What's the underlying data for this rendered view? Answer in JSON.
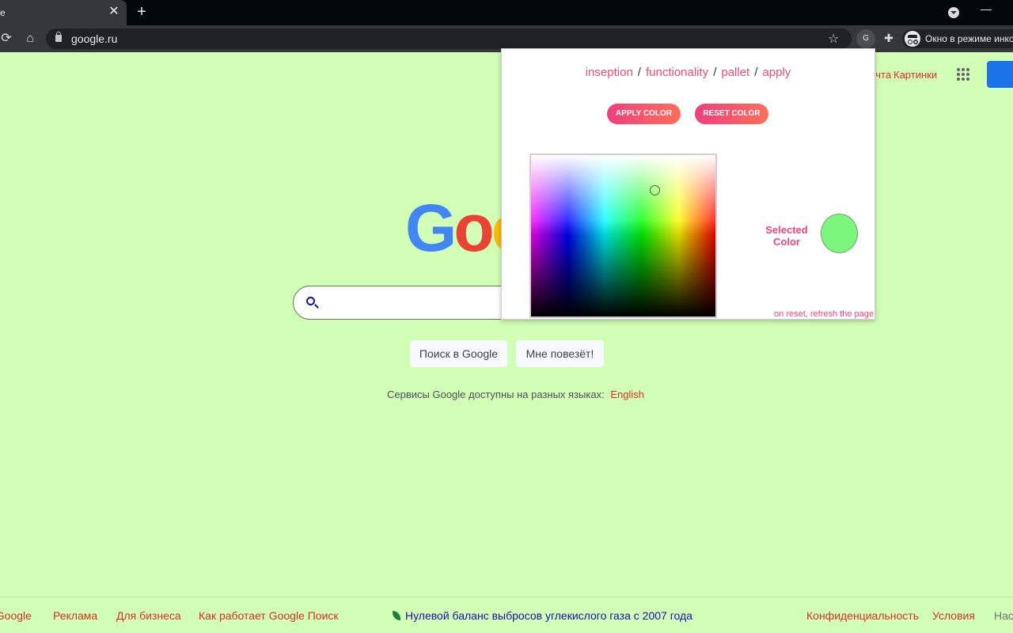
{
  "browser": {
    "tab_title": "е",
    "tab_close": "✕",
    "new_tab": "+",
    "url": "google.ru",
    "extension_letter": "G",
    "incognito_label": "Окно в режиме инкогнито",
    "icons": [
      "reload-icon",
      "home-icon",
      "lock-icon",
      "star-icon",
      "puzzle-icon",
      "incognito-icon"
    ]
  },
  "google": {
    "top_links": [
      "Почта",
      "Картинки"
    ],
    "logo_text": "Google",
    "logo_colors": [
      "#4285f4",
      "#ea4335",
      "#fbbc05",
      "#4285f4",
      "#34a853",
      "#ea4335"
    ],
    "search_placeholder": "",
    "buttons": {
      "search": "Поиск в Google",
      "lucky": "Мне повезёт!"
    },
    "languages_text": "Сервисы Google доступны на разных языках:",
    "languages_link": "English",
    "footer": {
      "left": [
        "О Google",
        "Реклама",
        "Для бизнеса",
        "Как работает Google Поиск"
      ],
      "center": "Нулевой баланс выбросов углекислого газа с 2007 года",
      "right": [
        "Конфиденциальность",
        "Условия",
        "Настройки"
      ]
    },
    "background_color": "#d1ffb5"
  },
  "extension": {
    "nav": [
      "inseption",
      "functionality",
      "pallet",
      "apply"
    ],
    "separator": "/",
    "apply_label": "APPLY COLOR",
    "reset_label": "RESET COLOR",
    "selected_label_line1": "Selected",
    "selected_label_line2": "Color",
    "selected_color": "#7cf67c",
    "note": "on reset, refresh the page",
    "accent_color": "#f24e6f"
  }
}
